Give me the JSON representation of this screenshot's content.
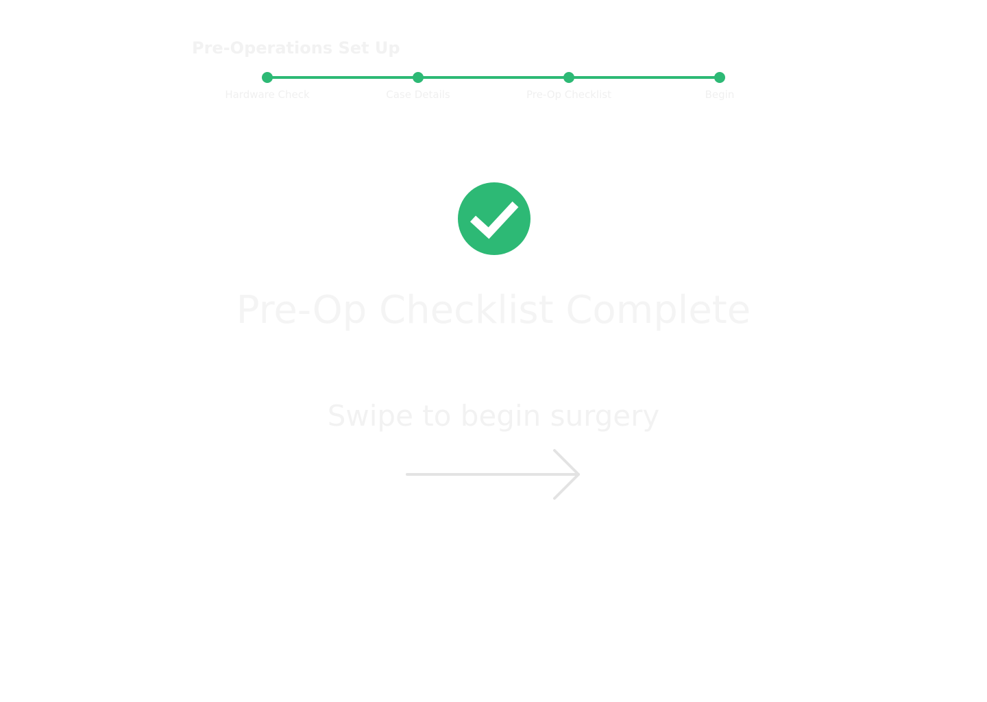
{
  "header": {
    "title": "Pre-Operations Set Up"
  },
  "stepper": {
    "steps": [
      {
        "label": "Hardware Check",
        "completed": true
      },
      {
        "label": "Case Details",
        "completed": true
      },
      {
        "label": "Pre-Op Checklist",
        "completed": true
      },
      {
        "label": "Begin",
        "completed": true
      }
    ],
    "accent_color": "#2db975"
  },
  "status": {
    "icon": "checkmark-circle-icon",
    "icon_color": "#2db975",
    "headline": "Pre-Op Checklist Complete"
  },
  "swipe": {
    "prompt": "Swipe to begin surgery",
    "icon": "arrow-right-icon"
  }
}
